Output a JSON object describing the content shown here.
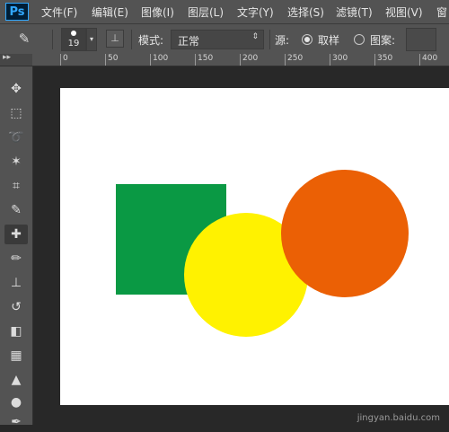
{
  "app": {
    "logo": "Ps"
  },
  "menu": [
    "文件(F)",
    "编辑(E)",
    "图像(I)",
    "图层(L)",
    "文字(Y)",
    "选择(S)",
    "滤镜(T)",
    "视图(V)",
    "窗"
  ],
  "options": {
    "brush_size": "19",
    "mode_label": "模式:",
    "mode_value": "正常",
    "source_label": "源:",
    "sampled_label": "取样",
    "pattern_label": "图案:"
  },
  "ruler": {
    "labels": [
      "0",
      "50",
      "100",
      "150",
      "200",
      "250",
      "300",
      "350",
      "400"
    ]
  },
  "tools": [
    "move-icon",
    "marquee-icon",
    "lasso-icon",
    "magic-wand-icon",
    "crop-icon",
    "eyedropper-icon",
    "healing-brush-icon",
    "brush-icon",
    "clone-stamp-icon",
    "history-brush-icon",
    "eraser-icon",
    "gradient-icon",
    "blur-icon",
    "dodge-icon",
    "pen-icon"
  ],
  "canvas": {
    "shapes": [
      {
        "shape": "square",
        "color": "#0a9944"
      },
      {
        "shape": "circle",
        "color": "#fff200"
      },
      {
        "shape": "circle",
        "color": "#eb6005"
      }
    ]
  },
  "watermark": "jingyan.baidu.com"
}
